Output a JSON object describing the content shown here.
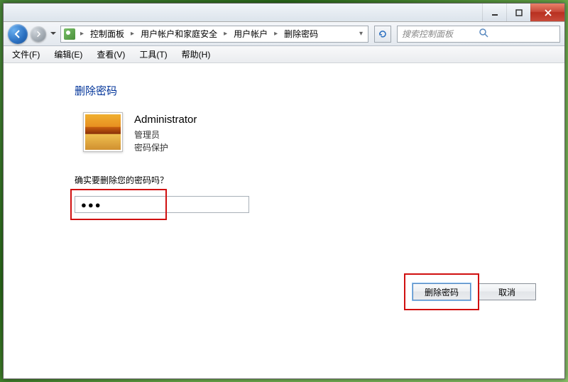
{
  "titlebar": {},
  "breadcrumb": {
    "items": [
      "控制面板",
      "用户帐户和家庭安全",
      "用户帐户",
      "删除密码"
    ]
  },
  "search": {
    "placeholder": "搜索控制面板"
  },
  "menu": {
    "file": "文件(F)",
    "edit": "编辑(E)",
    "view": "查看(V)",
    "tools": "工具(T)",
    "help": "帮助(H)"
  },
  "page": {
    "title": "删除密码",
    "user_name": "Administrator",
    "user_role": "管理员",
    "user_pw_status": "密码保护",
    "prompt": "确实要删除您的密码吗？",
    "password_value": "●●●"
  },
  "buttons": {
    "delete": "删除密码",
    "cancel": "取消"
  }
}
